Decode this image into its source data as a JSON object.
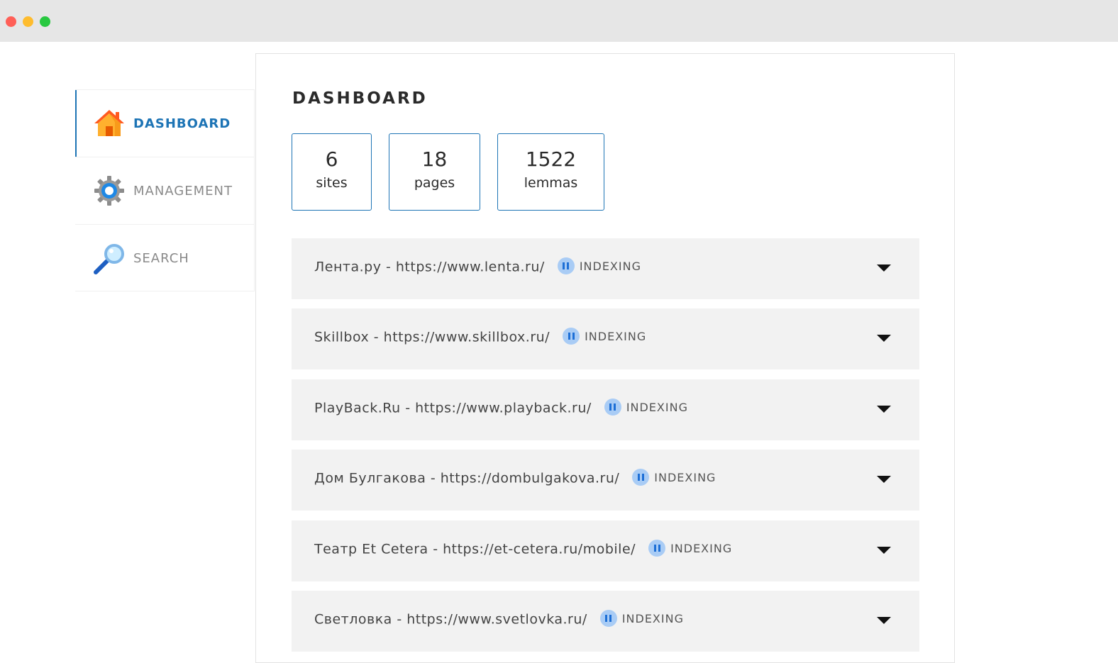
{
  "window": {
    "controls": [
      "close",
      "minimize",
      "maximize"
    ]
  },
  "sidebar": {
    "items": [
      {
        "label": "DASHBOARD",
        "icon": "home-icon",
        "active": true
      },
      {
        "label": "MANAGEMENT",
        "icon": "gear-icon",
        "active": false
      },
      {
        "label": "SEARCH",
        "icon": "magnifier-icon",
        "active": false
      }
    ]
  },
  "main": {
    "title": "DASHBOARD",
    "stats": [
      {
        "value": "6",
        "label": "sites"
      },
      {
        "value": "18",
        "label": "pages"
      },
      {
        "value": "1522",
        "label": "lemmas"
      }
    ],
    "sites": [
      {
        "name": "Лента.ру - https://www.lenta.ru/",
        "status": "INDEXING"
      },
      {
        "name": "Skillbox - https://www.skillbox.ru/",
        "status": "INDEXING"
      },
      {
        "name": "PlayBack.Ru - https://www.playback.ru/",
        "status": "INDEXING"
      },
      {
        "name": "Дом Булгакова - https://dombulgakova.ru/",
        "status": "INDEXING"
      },
      {
        "name": "Театр Et Cetera - https://et-cetera.ru/mobile/",
        "status": "INDEXING"
      },
      {
        "name": "Светловка - https://www.svetlovka.ru/",
        "status": "INDEXING"
      }
    ]
  },
  "colors": {
    "accent": "#1d74b5",
    "row_bg": "#f2f2f2",
    "status_icon": "#a9ccf5"
  }
}
